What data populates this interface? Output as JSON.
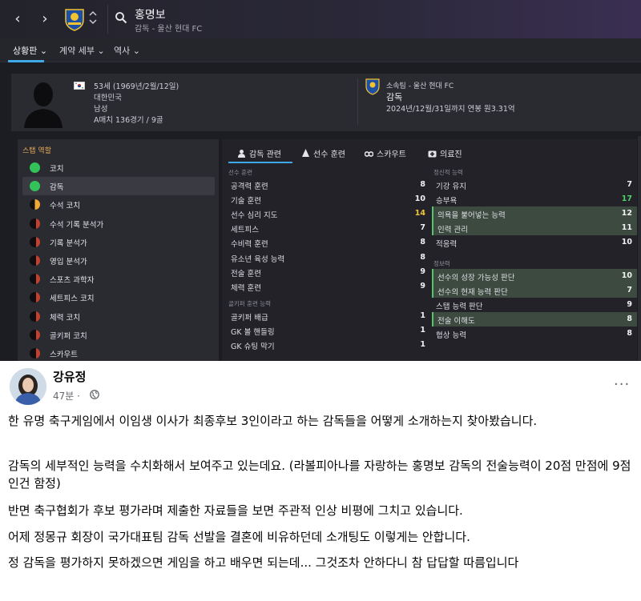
{
  "game": {
    "header": {
      "back": "‹",
      "forward": "›",
      "up_down": "˄˅",
      "manager_name": "홍명보",
      "manager_sub": "감독 - 울산 현대 FC"
    },
    "tabs": [
      "상황판",
      "계약 세부",
      "역사"
    ],
    "profile": {
      "age": "53세 (1969년/2월/12일)",
      "nation": "대한민국",
      "gender": "남성",
      "caps": "A매치 136경기 / 9골",
      "club": "소속팀 - 울산 현대 FC",
      "role": "감독",
      "contract": "2024년/12월/31일까지 연봉 원3.31억"
    },
    "staff_roles": {
      "title": "스탭 역할",
      "items": [
        {
          "label": "코치",
          "level": "full"
        },
        {
          "label": "감독",
          "level": "full",
          "selected": true
        },
        {
          "label": "수석 코치",
          "level": "half"
        },
        {
          "label": "수석 기록 분석가",
          "level": "low"
        },
        {
          "label": "기록 분석가",
          "level": "low"
        },
        {
          "label": "영입 분석가",
          "level": "low"
        },
        {
          "label": "스포츠 과학자",
          "level": "low"
        },
        {
          "label": "세트피스 코치",
          "level": "low"
        },
        {
          "label": "체력 코치",
          "level": "low"
        },
        {
          "label": "골키퍼 코치",
          "level": "low"
        },
        {
          "label": "스카우트",
          "level": "low"
        }
      ]
    },
    "attr_tabs": [
      "감독 관련",
      "선수 훈련",
      "스카우트",
      "의료진"
    ],
    "coaching": {
      "header": "선수 훈련",
      "items": [
        {
          "label": "공격력 훈련",
          "value": "8"
        },
        {
          "label": "기술 훈련",
          "value": "10"
        },
        {
          "label": "선수 심리 지도",
          "value": "14"
        },
        {
          "label": "세트피스",
          "value": "7"
        },
        {
          "label": "수비력 훈련",
          "value": "8"
        },
        {
          "label": "유소년 육성 능력",
          "value": "8"
        },
        {
          "label": "전술 훈련",
          "value": "9"
        },
        {
          "label": "체력 훈련",
          "value": "9"
        }
      ]
    },
    "goalkeeping": {
      "header": "골키퍼 훈련 능력",
      "items": [
        {
          "label": "골키퍼 배급",
          "value": "1"
        },
        {
          "label": "GK 볼 핸들링",
          "value": "1"
        },
        {
          "label": "GK 슈팅 막기",
          "value": "1"
        }
      ]
    },
    "mental": {
      "header": "정신적 능력",
      "items": [
        {
          "label": "기강 유지",
          "value": "7"
        },
        {
          "label": "승부욕",
          "value": "17"
        },
        {
          "label": "의욕을 불어넣는 능력",
          "value": "12"
        },
        {
          "label": "인력 관리",
          "value": "11"
        },
        {
          "label": "적응력",
          "value": "10"
        }
      ]
    },
    "knowledge": {
      "header": "정보력",
      "items": [
        {
          "label": "선수의 성장 가능성 판단",
          "value": "10"
        },
        {
          "label": "선수의 현재 능력 판단",
          "value": "7"
        },
        {
          "label": "스탭 능력 판단",
          "value": "9"
        },
        {
          "label": "전술 이해도",
          "value": "8"
        },
        {
          "label": "협상 능력",
          "value": "8"
        }
      ]
    }
  },
  "post": {
    "author": "강유정",
    "time": "47분 · ",
    "more": "···",
    "paragraphs": [
      "한 유명 축구게임에서 이임생 이사가 최종후보 3인이라고 하는 감독들을 어떻게 소개하는지 찾아봤습니다.",
      "감독의 세부적인 능력을 수치화해서 보여주고 있는데요. (라볼피아나를 자랑하는 홍명보 감독의 전술능력이 20점 만점에 9점인건 함정)",
      "반면 축구협회가 후보 평가라며 제출한 자료들을 보면 주관적 인상 비평에 그치고 있습니다.",
      "어제 정몽규 회장이 국가대표팀 감독 선발을 결혼에 비유하던데 소개팅도 이렇게는 안합니다.",
      "정 감독을 평가하지 못하겠으면 게임을 하고 배우면 되는데... 그것조차 안하다니 참 답답할 따름입니다"
    ]
  },
  "colors": {
    "accent": "#3fa9e8",
    "green": "#33c25a",
    "yellow": "#f3c43a",
    "highlight_row": "#3c4a40"
  }
}
